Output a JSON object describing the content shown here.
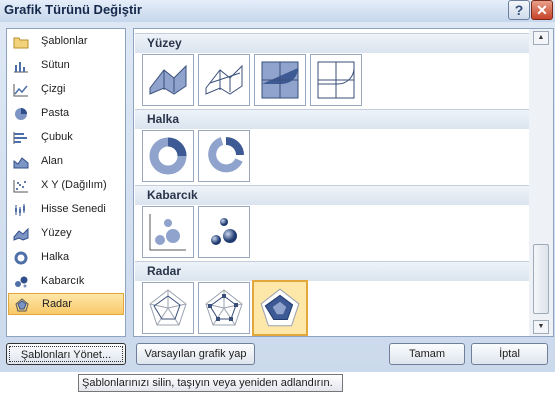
{
  "window": {
    "title": "Grafik Türünü Değiştir",
    "help_glyph": "?",
    "close_glyph": "✕"
  },
  "chart_types": [
    {
      "label": "Şablonlar",
      "icon": "folder-icon"
    },
    {
      "label": "Sütun",
      "icon": "column-chart-icon"
    },
    {
      "label": "Çizgi",
      "icon": "line-chart-icon"
    },
    {
      "label": "Pasta",
      "icon": "pie-chart-icon"
    },
    {
      "label": "Çubuk",
      "icon": "bar-chart-icon"
    },
    {
      "label": "Alan",
      "icon": "area-chart-icon"
    },
    {
      "label": "X Y (Dağılım)",
      "icon": "scatter-chart-icon"
    },
    {
      "label": "Hisse Senedi",
      "icon": "stock-chart-icon"
    },
    {
      "label": "Yüzey",
      "icon": "surface-chart-icon"
    },
    {
      "label": "Halka",
      "icon": "doughnut-chart-icon"
    },
    {
      "label": "Kabarcık",
      "icon": "bubble-chart-icon"
    },
    {
      "label": "Radar",
      "icon": "radar-chart-icon",
      "selected": true
    }
  ],
  "sections": [
    {
      "title": "Yüzey",
      "thumbs": [
        "3d-surface-icon",
        "wireframe-3d-surface-icon",
        "contour-icon",
        "wireframe-contour-icon"
      ]
    },
    {
      "title": "Halka",
      "thumbs": [
        "doughnut-icon",
        "exploded-doughnut-icon"
      ]
    },
    {
      "title": "Kabarcık",
      "thumbs": [
        "bubble-icon",
        "3d-bubble-icon"
      ]
    },
    {
      "title": "Radar",
      "thumbs": [
        "radar-icon",
        "radar-with-markers-icon",
        "filled-radar-icon"
      ],
      "selected_index": 2
    }
  ],
  "buttons": {
    "manage_templates": "Şablonları Yönet...",
    "set_default": "Varsayılan grafik yap",
    "ok": "Tamam",
    "cancel": "İptal"
  },
  "tooltip": "Şablonlarınızı silin, taşıyın veya yeniden adlandırın.",
  "colors": {
    "selected_bg": "#fde7a9",
    "selected_border": "#e3a73c",
    "accent": "#4f6fa8"
  }
}
